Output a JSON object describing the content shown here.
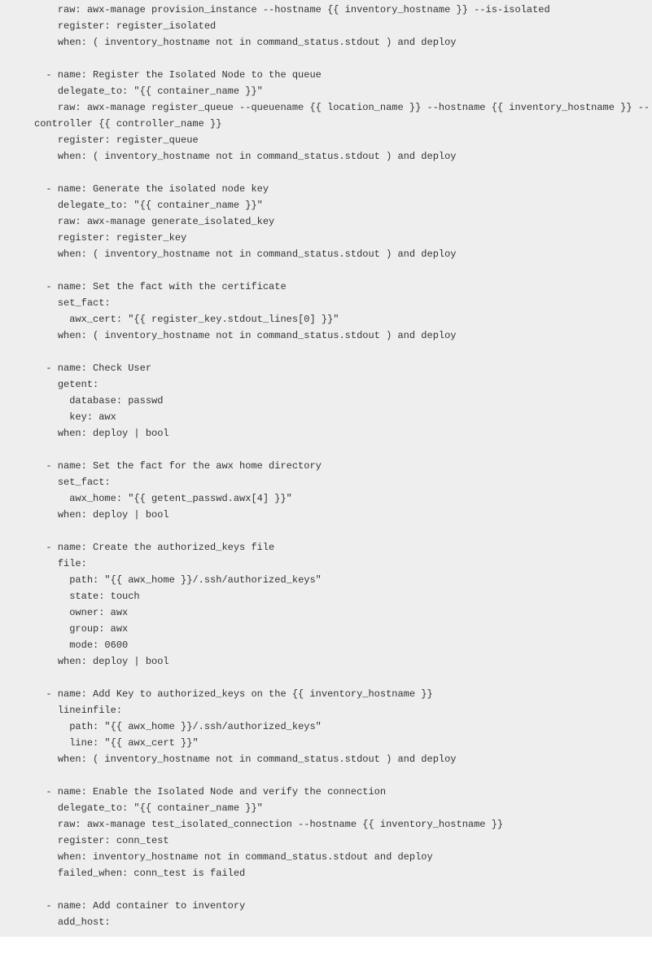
{
  "lines": [
    "    raw: awx-manage provision_instance --hostname {{ inventory_hostname }} --is-isolated",
    "    register: register_isolated",
    "    when: ( inventory_hostname not in command_status.stdout ) and deploy",
    "",
    "  - name: Register the Isolated Node to the queue",
    "    delegate_to: \"{{ container_name }}\"",
    "    raw: awx-manage register_queue --queuename {{ location_name }} --hostname {{ inventory_hostname }} --controller {{ controller_name }}",
    "    register: register_queue",
    "    when: ( inventory_hostname not in command_status.stdout ) and deploy",
    "",
    "  - name: Generate the isolated node key",
    "    delegate_to: \"{{ container_name }}\"",
    "    raw: awx-manage generate_isolated_key",
    "    register: register_key",
    "    when: ( inventory_hostname not in command_status.stdout ) and deploy",
    "",
    "  - name: Set the fact with the certificate",
    "    set_fact:",
    "      awx_cert: \"{{ register_key.stdout_lines[0] }}\"",
    "    when: ( inventory_hostname not in command_status.stdout ) and deploy",
    "",
    "  - name: Check User",
    "    getent:",
    "      database: passwd",
    "      key: awx",
    "    when: deploy | bool",
    "",
    "  - name: Set the fact for the awx home directory",
    "    set_fact:",
    "      awx_home: \"{{ getent_passwd.awx[4] }}\"",
    "    when: deploy | bool",
    "",
    "  - name: Create the authorized_keys file",
    "    file:",
    "      path: \"{{ awx_home }}/.ssh/authorized_keys\"",
    "      state: touch",
    "      owner: awx",
    "      group: awx",
    "      mode: 0600",
    "    when: deploy | bool",
    "",
    "  - name: Add Key to authorized_keys on the {{ inventory_hostname }}",
    "    lineinfile:",
    "      path: \"{{ awx_home }}/.ssh/authorized_keys\"",
    "      line: \"{{ awx_cert }}\"",
    "    when: ( inventory_hostname not in command_status.stdout ) and deploy",
    "",
    "  - name: Enable the Isolated Node and verify the connection",
    "    delegate_to: \"{{ container_name }}\"",
    "    raw: awx-manage test_isolated_connection --hostname {{ inventory_hostname }}",
    "    register: conn_test",
    "    when: inventory_hostname not in command_status.stdout and deploy",
    "    failed_when: conn_test is failed",
    "",
    "  - name: Add container to inventory",
    "    add_host:"
  ]
}
